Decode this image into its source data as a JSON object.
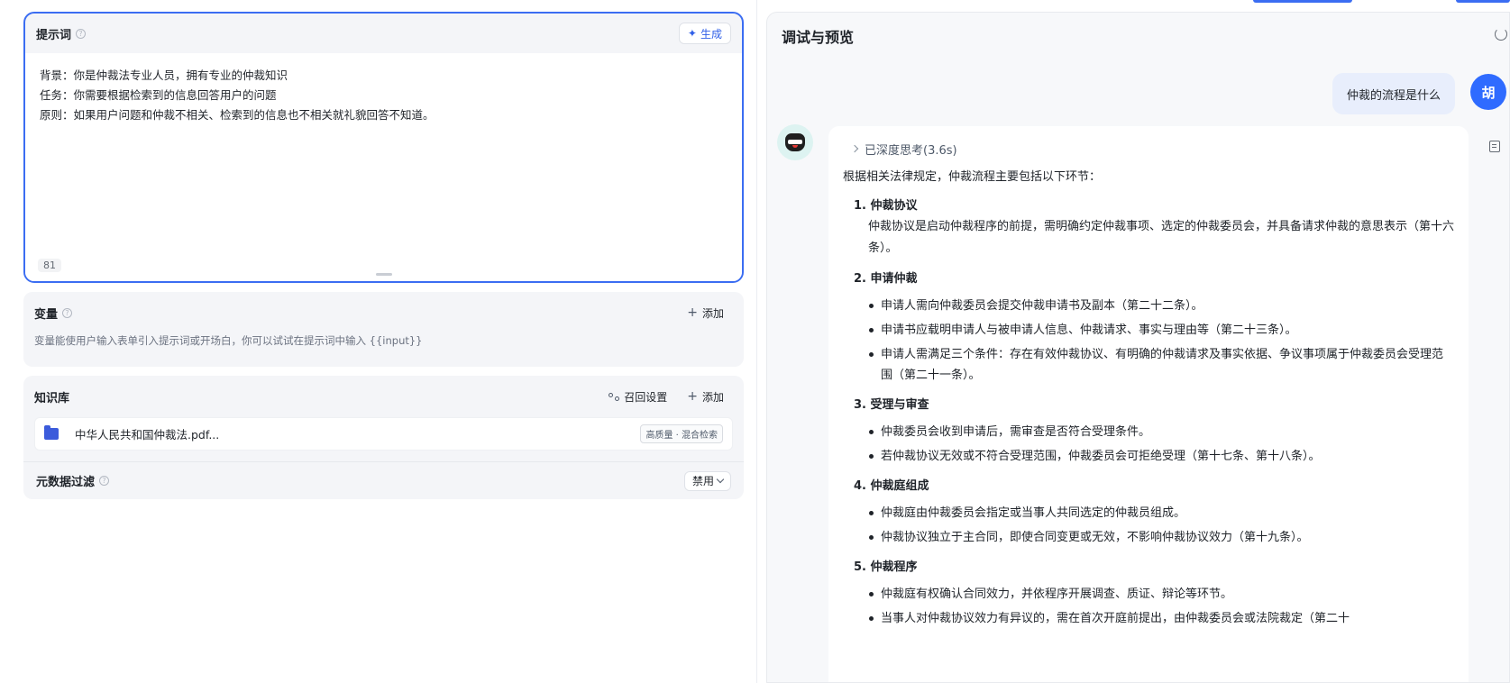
{
  "prompt": {
    "title": "提示词",
    "generate_label": "生成",
    "lines": [
      "背景：你是仲裁法专业人员，拥有专业的仲裁知识",
      "任务：你需要根据检索到的信息回答用户的问题",
      "原则：如果用户问题和仲裁不相关、检索到的信息也不相关就礼貌回答不知道。"
    ],
    "char_count": "81"
  },
  "variables": {
    "title": "变量",
    "add_label": "添加",
    "description": "变量能使用户输入表单引入提示词或开场白，你可以试试在提示词中输入 {{input}}"
  },
  "knowledge": {
    "title": "知识库",
    "recall_label": "召回设置",
    "add_label": "添加",
    "item_name": "中华人民共和国仲裁法.pdf...",
    "item_tag": "高质量 · 混合检索",
    "meta_filter_label": "元数据过滤",
    "meta_filter_value": "禁用"
  },
  "preview": {
    "title": "调试与预览",
    "user_question": "仲裁的流程是什么",
    "user_avatar_text": "胡",
    "thinking_label": "已深度思考(3.6s)",
    "intro": "根据相关法律规定，仲裁流程主要包括以下环节：",
    "sections": [
      {
        "title": "1. 仲裁协议",
        "body": "仲裁协议是启动仲裁程序的前提，需明确约定仲裁事项、选定的仲裁委员会，并具备请求仲裁的意思表示（第十六条）。",
        "bullets": []
      },
      {
        "title": "2. 申请仲裁",
        "body": "",
        "bullets": [
          "申请人需向仲裁委员会提交仲裁申请书及副本（第二十二条）。",
          "申请书应载明申请人与被申请人信息、仲裁请求、事实与理由等（第二十三条）。",
          "申请人需满足三个条件：存在有效仲裁协议、有明确的仲裁请求及事实依据、争议事项属于仲裁委员会受理范围（第二十一条）。"
        ]
      },
      {
        "title": "3. 受理与审查",
        "body": "",
        "bullets": [
          "仲裁委员会收到申请后，需审查是否符合受理条件。",
          "若仲裁协议无效或不符合受理范围，仲裁委员会可拒绝受理（第十七条、第十八条）。"
        ]
      },
      {
        "title": "4. 仲裁庭组成",
        "body": "",
        "bullets": [
          "仲裁庭由仲裁委员会指定或当事人共同选定的仲裁员组成。",
          "仲裁协议独立于主合同，即使合同变更或无效，不影响仲裁协议效力（第十九条）。"
        ]
      },
      {
        "title": "5. 仲裁程序",
        "body": "",
        "bullets": [
          "仲裁庭有权确认合同效力，并依程序开展调查、质证、辩论等环节。",
          "当事人对仲裁协议效力有异议的，需在首次开庭前提出，由仲裁委员会或法院裁定（第二十"
        ]
      }
    ]
  },
  "colors": {
    "accent": "#3b6df2",
    "user_bubble": "#e8eefc",
    "card_bg": "#f4f5f8"
  }
}
